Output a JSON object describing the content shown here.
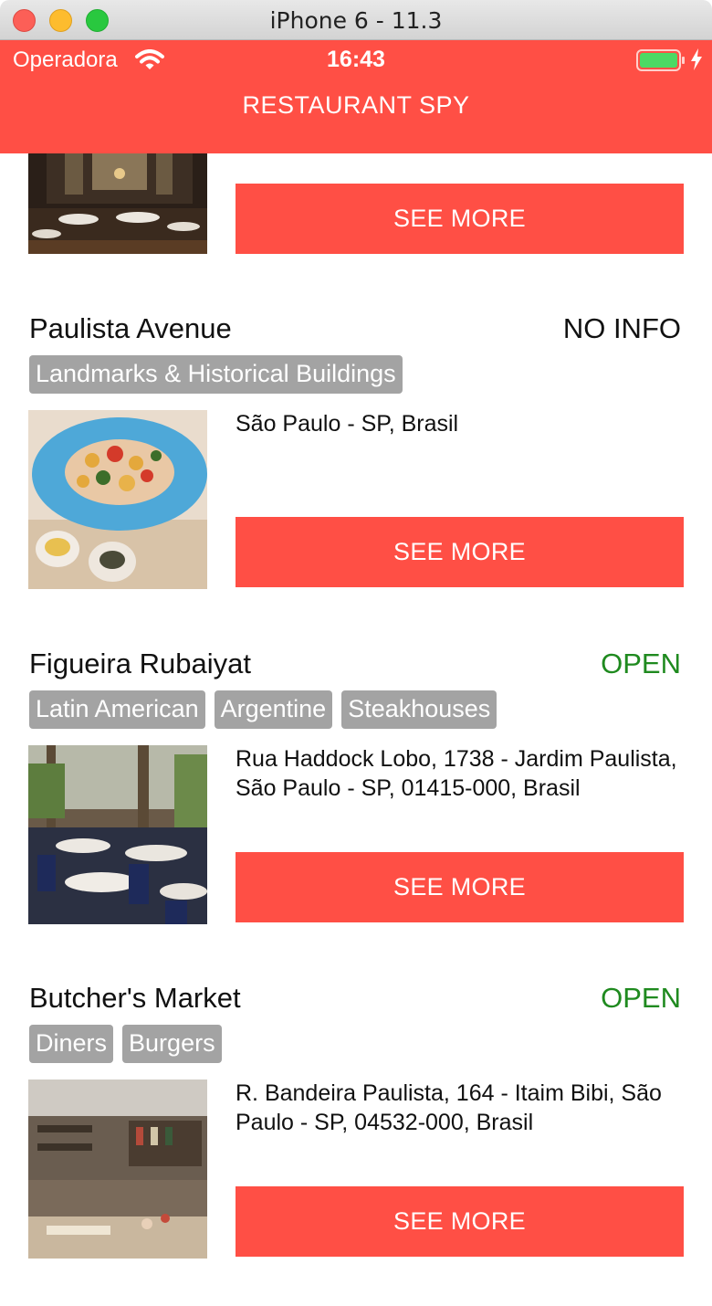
{
  "window": {
    "title": "iPhone 6 - 11.3"
  },
  "status_bar": {
    "carrier": "Operadora",
    "time": "16:43"
  },
  "nav": {
    "title": "RESTAURANT SPY"
  },
  "colors": {
    "brand": "#ff4f45",
    "open": "#1f8a1f",
    "no_info": "#111111",
    "tag_bg": "#a3a3a3"
  },
  "restaurants": [
    {
      "see_more_label": "SEE MORE"
    },
    {
      "name": "Paulista Avenue",
      "status": "NO INFO",
      "tags": [
        "Landmarks & Historical Buildings"
      ],
      "address": "São Paulo - SP, Brasil",
      "see_more_label": "SEE MORE"
    },
    {
      "name": "Figueira Rubaiyat",
      "status": "OPEN",
      "tags": [
        "Latin American",
        "Argentine",
        "Steakhouses"
      ],
      "address": "Rua Haddock Lobo, 1738 - Jardim Paulista, São Paulo - SP, 01415-000, Brasil",
      "see_more_label": "SEE MORE"
    },
    {
      "name": "Butcher's Market",
      "status": "OPEN",
      "tags": [
        "Diners",
        "Burgers"
      ],
      "address": "R. Bandeira Paulista, 164 - Itaim Bibi, São Paulo - SP, 04532-000, Brasil",
      "see_more_label": "SEE MORE"
    }
  ]
}
